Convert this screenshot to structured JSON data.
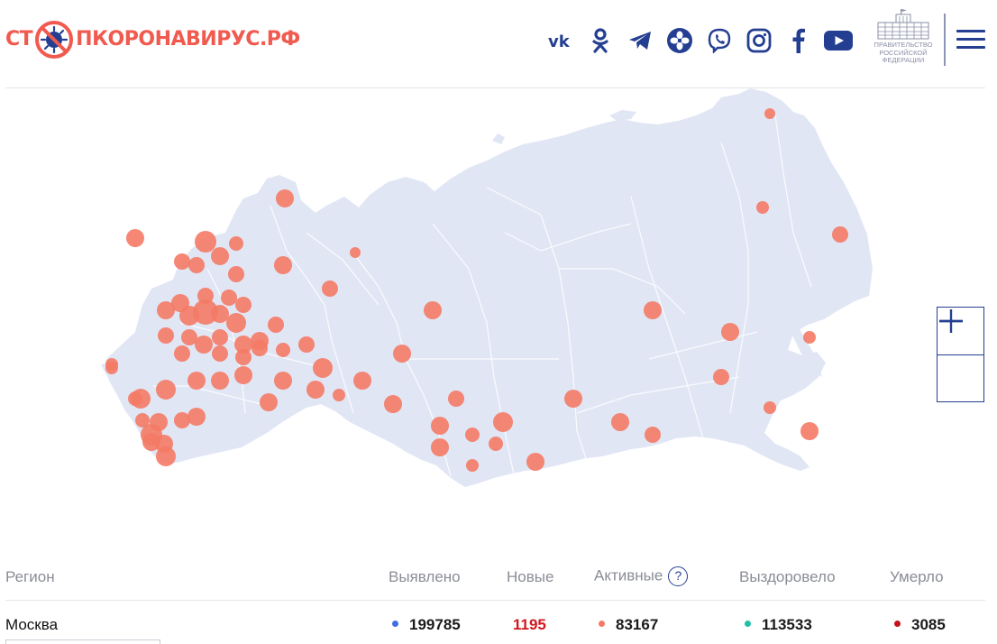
{
  "header": {
    "logo": {
      "part1": "СТ",
      "part2": "ПКОРОНАВИРУС",
      "part3": ".РФ"
    },
    "socials": [
      {
        "name": "vk-icon",
        "label": "VK"
      },
      {
        "name": "odnoklassniki-icon"
      },
      {
        "name": "telegram-icon"
      },
      {
        "name": "yandex-zen-icon"
      },
      {
        "name": "viber-icon"
      },
      {
        "name": "instagram-icon"
      },
      {
        "name": "facebook-icon"
      },
      {
        "name": "youtube-icon"
      }
    ],
    "gov_label_line1": "ПРАВИТЕЛЬСТВО",
    "gov_label_line2": "РОССИЙСКОЙ",
    "gov_label_line3": "ФЕДЕРАЦИИ"
  },
  "colors": {
    "brand_blue": "#243f91",
    "brand_red": "#f05a4f",
    "land": "#e1e6f5",
    "case_bubble": "#f47a65"
  },
  "map": {
    "zoom_in": "+",
    "zoom_out": "−"
  },
  "table": {
    "headers": {
      "region": "Регион",
      "detected": "Выявлено",
      "new": "Новые",
      "active": "Активные",
      "active_help": "?",
      "recovered": "Выздоровело",
      "died": "Умерло"
    },
    "rows": [
      {
        "region": "Москва",
        "detected": "199785",
        "new": "1195",
        "active": "83167",
        "recovered": "113533",
        "died": "3085"
      }
    ],
    "dot_colors": {
      "detected": "#3f6fe0",
      "active": "#f47a65",
      "recovered": "#22c0a8",
      "died": "#c4141b"
    }
  }
}
